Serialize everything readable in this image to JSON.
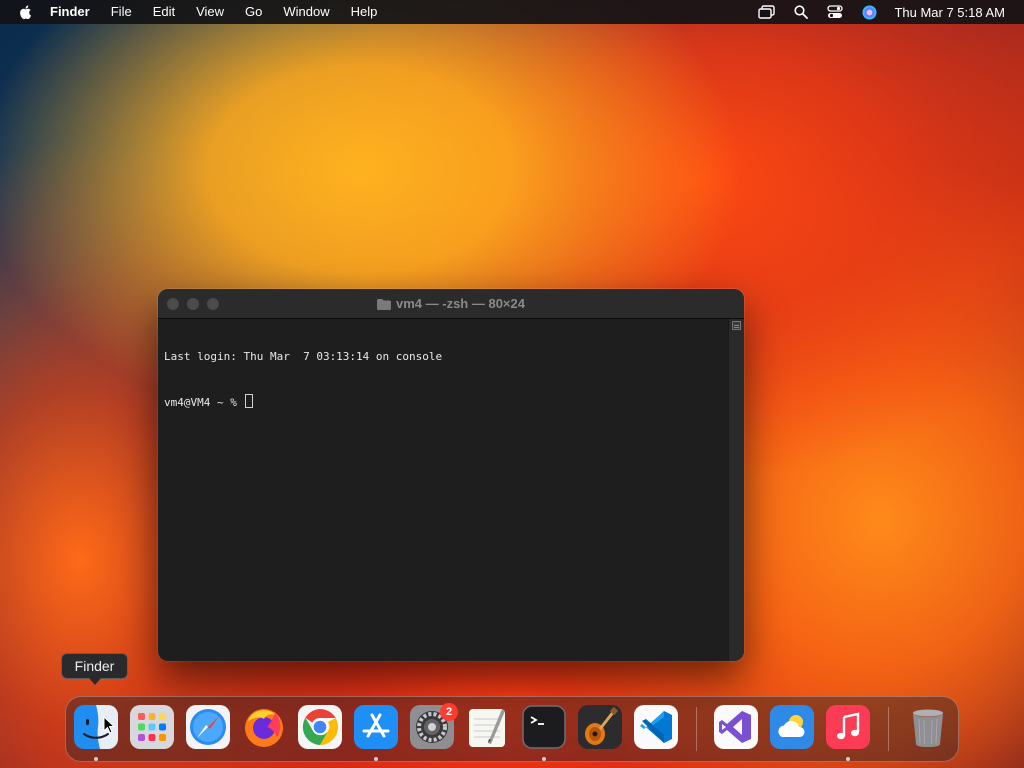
{
  "menubar": {
    "apple_icon": "apple-logo",
    "items": [
      "Finder",
      "File",
      "Edit",
      "View",
      "Go",
      "Window",
      "Help"
    ],
    "status_icons": [
      "screen-mirroring-icon",
      "search-icon",
      "control-center-icon",
      "siri-icon"
    ],
    "clock": "Thu Mar 7  5:18 AM"
  },
  "terminal": {
    "title": "vm4 — -zsh — 80×24",
    "lines": [
      "Last login: Thu Mar  7 03:13:14 on console",
      "vm4@VM4 ~ % "
    ]
  },
  "tooltip": {
    "text": "Finder"
  },
  "dock": {
    "apps": [
      {
        "name": "Finder",
        "running": true
      },
      {
        "name": "Launchpad",
        "running": false
      },
      {
        "name": "Safari",
        "running": false
      },
      {
        "name": "Firefox",
        "running": false
      },
      {
        "name": "Google Chrome",
        "running": false
      },
      {
        "name": "App Store",
        "running": true
      },
      {
        "name": "System Settings",
        "running": false,
        "badge": "2"
      },
      {
        "name": "TextEdit",
        "running": false
      },
      {
        "name": "Terminal",
        "running": true
      },
      {
        "name": "GarageBand",
        "running": false
      },
      {
        "name": "Visual Studio Code",
        "running": false
      },
      {
        "name": "Visual Studio",
        "running": false
      },
      {
        "name": "Weather",
        "running": false
      },
      {
        "name": "Music",
        "running": true
      },
      {
        "name": "Trash",
        "running": false
      }
    ]
  },
  "colors": {
    "menubar_bg": "#121216",
    "terminal_bg": "#1e1e1e",
    "badge": "#ff3b30"
  }
}
